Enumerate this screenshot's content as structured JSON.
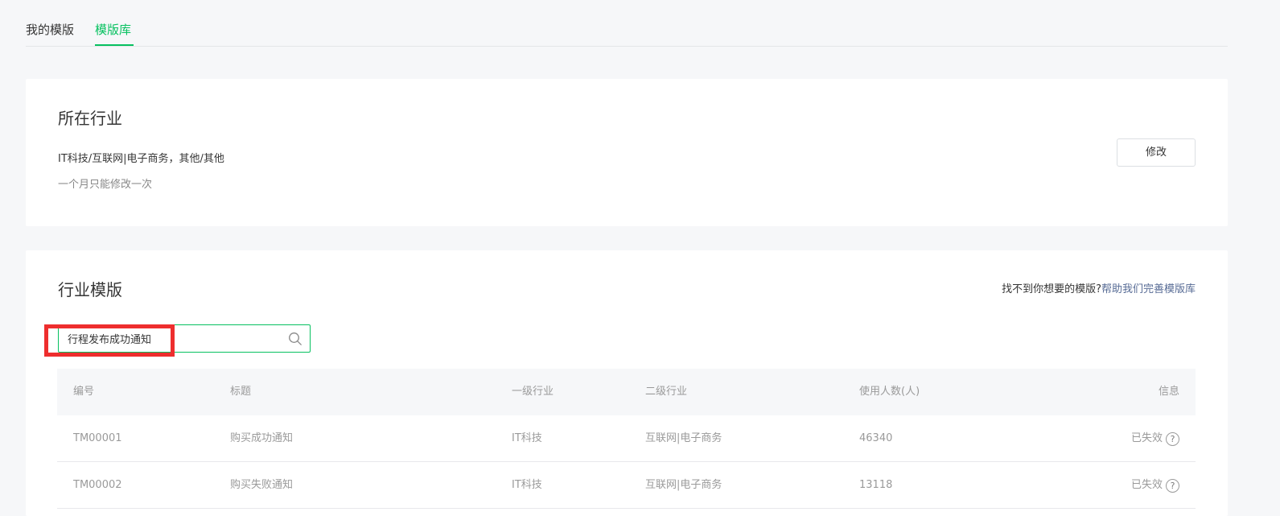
{
  "tabs": [
    {
      "label": "我的模版",
      "active": false
    },
    {
      "label": "模版库",
      "active": true
    }
  ],
  "accent_color": "#07c160",
  "highlight_color": "#ee2e2e",
  "industry": {
    "title": "所在行业",
    "value": "IT科技/互联网|电子商务，其他/其他",
    "hint": "一个月只能修改一次",
    "modify_label": "修改"
  },
  "templates": {
    "title": "行业模版",
    "help_question": "找不到你想要的模版?",
    "help_link": "帮助我们完善模版库",
    "search_value": "行程发布成功通知",
    "search_icon": "search-icon",
    "columns": [
      "编号",
      "标题",
      "一级行业",
      "二级行业",
      "使用人数(人)",
      "信息"
    ],
    "rows": [
      {
        "id": "TM00001",
        "title": "购买成功通知",
        "level1": "IT科技",
        "level2": "互联网|电子商务",
        "users": "46340",
        "status": "已失效"
      },
      {
        "id": "TM00002",
        "title": "购买失败通知",
        "level1": "IT科技",
        "level2": "互联网|电子商务",
        "users": "13118",
        "status": "已失效"
      }
    ]
  }
}
